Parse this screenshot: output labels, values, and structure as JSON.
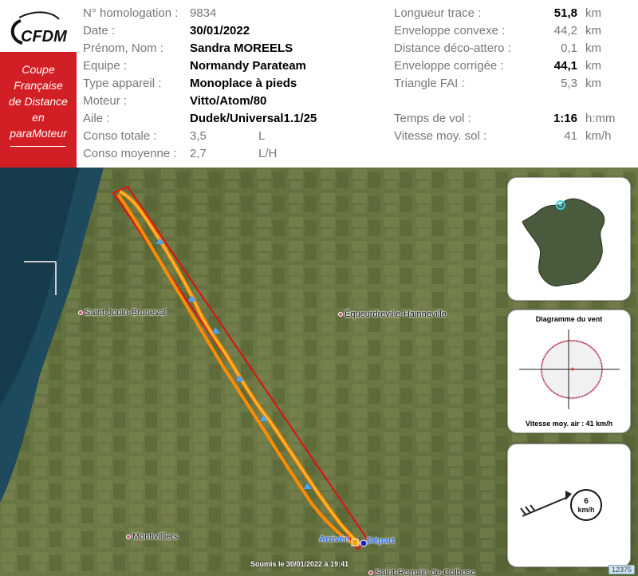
{
  "logo": {
    "text": "CFDM"
  },
  "banner": {
    "lines": [
      "Coupe",
      "Française",
      "de Distance",
      "en",
      "paraMoteur"
    ]
  },
  "left_fields": [
    {
      "label": "N° homologation :",
      "value": "9834",
      "bold": false
    },
    {
      "label": "Date :",
      "value": "30/01/2022",
      "bold": true
    },
    {
      "label": "Prénom, Nom :",
      "value": "Sandra MOREELS",
      "bold": true
    },
    {
      "label": "Equipe :",
      "value": "Normandy Parateam",
      "bold": true
    },
    {
      "label": "Type appareil :",
      "value": "Monoplace à pieds",
      "bold": true
    },
    {
      "label": "Moteur :",
      "value": "Vitto/Atom/80",
      "bold": true
    },
    {
      "label": "Aile :",
      "value": "Dudek/Universal1.1/25",
      "bold": true
    },
    {
      "label": "Conso totale :",
      "value": "3,5",
      "unit": "L",
      "bold": false
    },
    {
      "label": "Conso moyenne :",
      "value": "2,7",
      "unit": "L/H",
      "bold": false
    }
  ],
  "right_fields": [
    {
      "label": "Longueur trace :",
      "value": "51,8",
      "unit": "km",
      "bold": true
    },
    {
      "label": "Enveloppe convexe :",
      "value": "44,2",
      "unit": "km",
      "bold": false
    },
    {
      "label": "Distance déco-attero :",
      "value": "0,1",
      "unit": "km",
      "bold": false
    },
    {
      "label": "Enveloppe corrigée :",
      "value": "44,1",
      "unit": "km",
      "bold": true
    },
    {
      "label": "Triangle FAI :",
      "value": "5,3",
      "unit": "km",
      "bold": false
    },
    {
      "label": "Temps de vol :",
      "value": "1:16",
      "unit": "h:mm",
      "bold": true
    },
    {
      "label": "Vitesse moy. sol :",
      "value": "41",
      "unit": "km/h",
      "bold": false
    }
  ],
  "map": {
    "places": [
      {
        "name": "Saint-Jouin-Bruneval"
      },
      {
        "name": "Équeurdreville-Hainneville"
      },
      {
        "name": "Montivilliers"
      },
      {
        "name": "Saint-Romain-de-Colbosc"
      }
    ],
    "markers": {
      "arrival": "Arrivée",
      "departure": "Départ"
    },
    "footer": "Soumis le 30/01/2022 à 19:41",
    "id": "12375"
  },
  "wind_panel": {
    "title": "Diagramme du vent",
    "footer": "Vitesse moy. air : 41 km/h"
  },
  "wind_speed_panel": {
    "value": "6",
    "unit": "km/h"
  },
  "colors": {
    "banner_red": "#d21f25",
    "track_orange": "#ff8c00",
    "track_red": "#e01010",
    "marker_blue": "#2b6ef0"
  }
}
